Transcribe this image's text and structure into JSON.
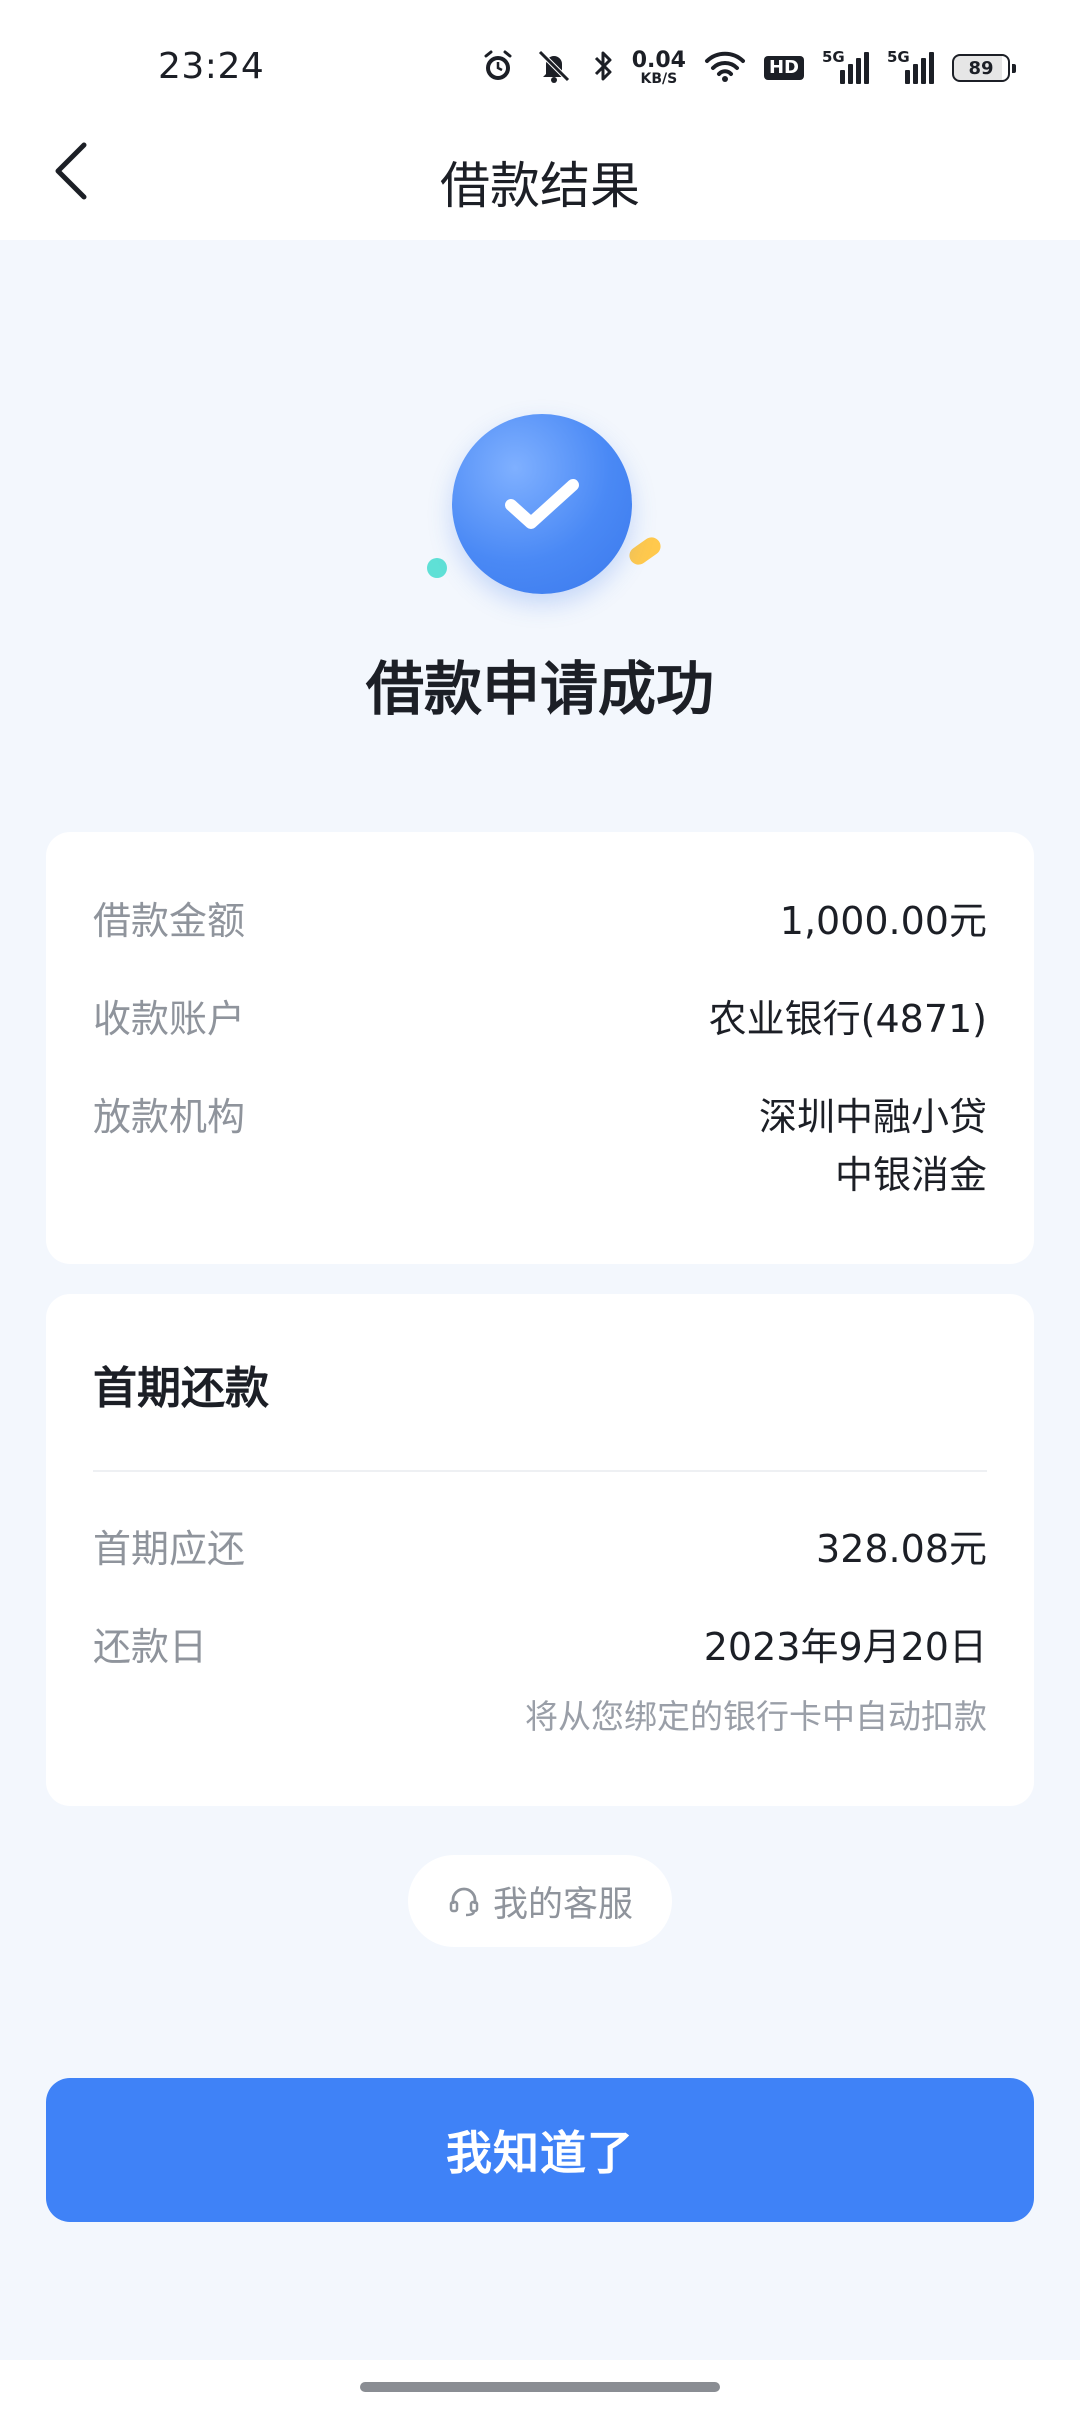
{
  "status_bar": {
    "time": "23:24",
    "net_speed_value": "0.04",
    "net_speed_unit": "KB/S",
    "hd_label": "HD",
    "sim1_type": "5G",
    "sim2_type": "5G",
    "battery": "89"
  },
  "header": {
    "title": "借款结果"
  },
  "result": {
    "title": "借款申请成功"
  },
  "loan_details": {
    "rows": [
      {
        "label": "借款金额",
        "value": "1,000.00元"
      },
      {
        "label": "收款账户",
        "value": "农业银行(4871)"
      },
      {
        "label": "放款机构",
        "value_line1": "深圳中融小贷",
        "value_line2": "中银消金"
      }
    ]
  },
  "first_repayment": {
    "title": "首期还款",
    "rows": [
      {
        "label": "首期应还",
        "value": "328.08元"
      },
      {
        "label": "还款日",
        "value": "2023年9月20日"
      }
    ],
    "note": "将从您绑定的银行卡中自动扣款"
  },
  "service": {
    "label": "我的客服"
  },
  "actions": {
    "confirm_label": "我知道了"
  },
  "colors": {
    "accent": "#3f82f7",
    "background": "#f3f7fd"
  }
}
